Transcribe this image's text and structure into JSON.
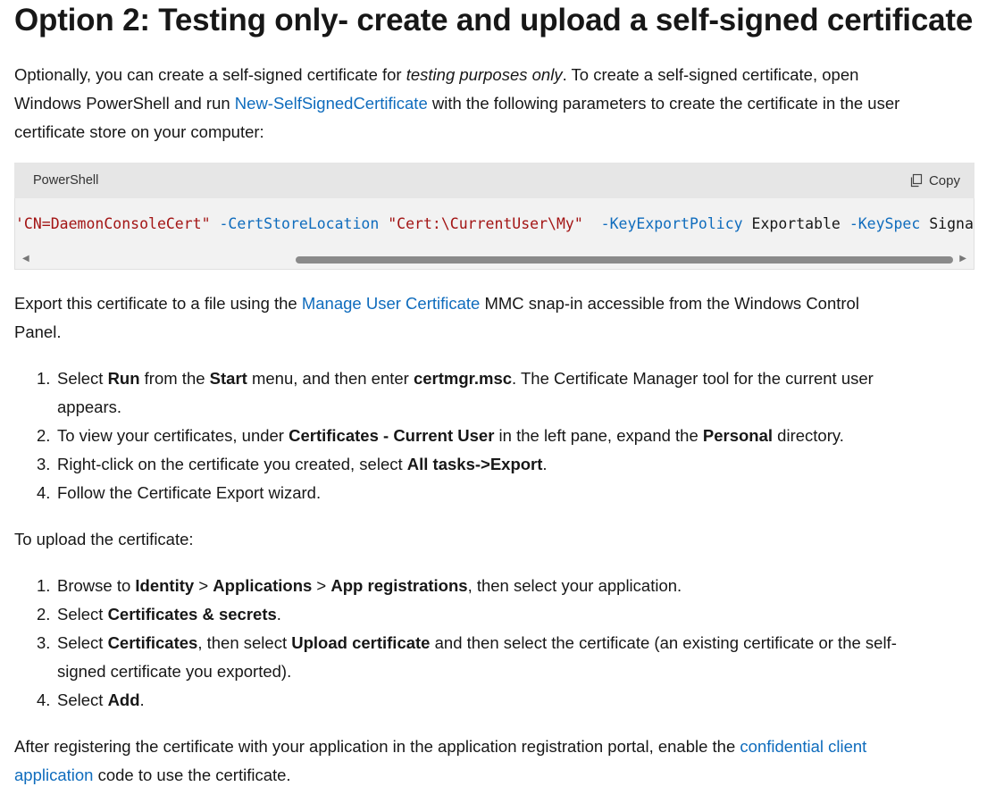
{
  "heading": "Option 2: Testing only- create and upload a self-signed certificate",
  "intro": {
    "t1": "Optionally, you can create a self-signed certificate for ",
    "em": "testing purposes only",
    "t2": ". To create a self-signed certificate, open",
    "t3": "Windows PowerShell and run ",
    "link": "New-SelfSignedCertificate",
    "t4": " with the following parameters to create the certificate in the user",
    "t5": "certificate store on your computer:"
  },
  "code": {
    "language": "PowerShell",
    "copy_label": "Copy",
    "s1": "'CN=DaemonConsoleCert\"",
    "p1": " -CertStoreLocation ",
    "s2": "\"Cert:\\CurrentUser\\My\"",
    "p2": "  -KeyExportPolicy",
    "v1": " Exportable ",
    "p3": "-KeySpec",
    "v2": " Signature"
  },
  "export": {
    "t1": "Export this certificate to a file using the ",
    "link": "Manage User Certificate",
    "t2": " MMC snap-in accessible from the Windows Control",
    "t3": "Panel."
  },
  "steps1": [
    {
      "n": "1.",
      "a": "Select ",
      "b1": "Run",
      "c": " from the ",
      "b2": "Start",
      "d": " menu, and then enter ",
      "b3": "certmgr.msc",
      "e": ". The Certificate Manager tool for the current user",
      "f": "appears."
    },
    {
      "n": "2.",
      "a": "To view your certificates, under ",
      "b1": "Certificates - Current User",
      "c": " in the left pane, expand the ",
      "b2": "Personal",
      "d": " directory."
    },
    {
      "n": "3.",
      "a": "Right-click on the certificate you created, select ",
      "b1": "All tasks->Export",
      "c": "."
    },
    {
      "n": "4.",
      "a": "Follow the Certificate Export wizard."
    }
  ],
  "upload_intro": "To upload the certificate:",
  "steps2": [
    {
      "n": "1.",
      "a": "Browse to ",
      "b1": "Identity",
      "c": " > ",
      "b2": "Applications",
      "d": " > ",
      "b3": "App registrations",
      "e": ", then select your application."
    },
    {
      "n": "2.",
      "a": "Select ",
      "b1": "Certificates & secrets",
      "c": "."
    },
    {
      "n": "3.",
      "a": "Select ",
      "b1": "Certificates",
      "c": ", then select ",
      "b2": "Upload certificate",
      "d": " and then select the certificate (an existing certificate or the self-",
      "e": "signed certificate you exported)."
    },
    {
      "n": "4.",
      "a": "Select ",
      "b1": "Add",
      "c": "."
    }
  ],
  "closing": {
    "t1": "After registering the certificate with your application in the application registration portal, enable the ",
    "link1": "confidential client",
    "link2": "application",
    "t2": " code to use the certificate."
  }
}
